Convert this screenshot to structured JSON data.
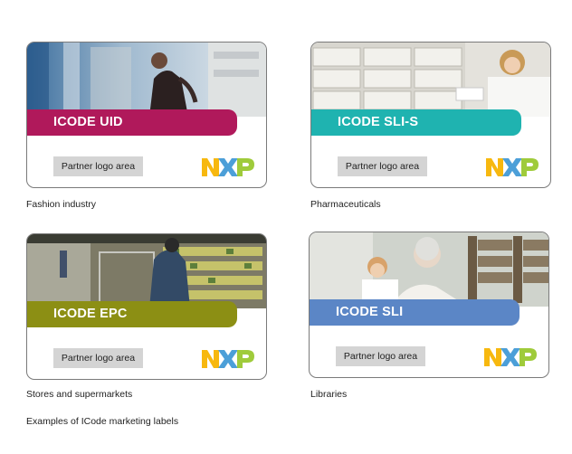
{
  "cards": [
    {
      "band": "ICODE UID",
      "partner": "Partner logo area",
      "caption": "Fashion industry",
      "band_color": "#b0195b"
    },
    {
      "band": "ICODE SLI-S",
      "partner": "Partner logo area",
      "caption": "Pharmaceuticals",
      "band_color": "#1fb3b0"
    },
    {
      "band": "ICODE EPC",
      "partner": "Partner logo area",
      "caption": "Stores and supermarkets",
      "band_color": "#8c8f14"
    },
    {
      "band": "ICODE SLI",
      "partner": "Partner logo area",
      "caption": "Libraries",
      "band_color": "#5b86c6"
    }
  ],
  "logo_text": "NXP",
  "logo_colors": {
    "n": "#f7b80f",
    "x": "#4c9fd8",
    "p": "#9fcb3b"
  },
  "footer": "Examples of ICode marketing labels"
}
